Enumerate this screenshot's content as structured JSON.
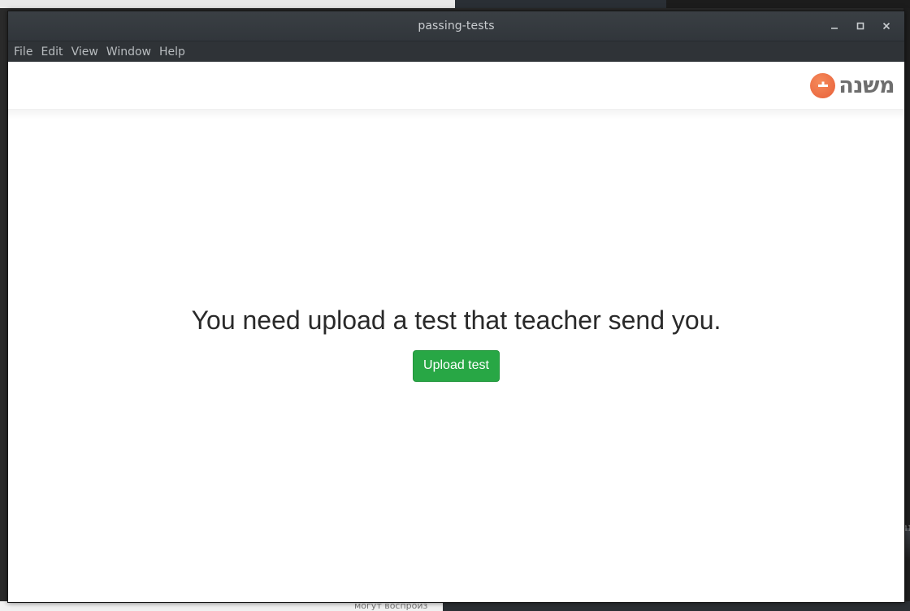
{
  "window": {
    "title": "passing-tests",
    "controls": {
      "minimize_icon": "minimize-icon",
      "maximize_icon": "maximize-icon",
      "close_icon": "close-icon"
    }
  },
  "menubar": {
    "items": [
      {
        "label": "File"
      },
      {
        "label": "Edit"
      },
      {
        "label": "View"
      },
      {
        "label": "Window"
      },
      {
        "label": "Help"
      }
    ]
  },
  "header": {
    "logo_text": "משנה",
    "logo_icon": "minus-badge-icon",
    "accent_color": "#e9673f"
  },
  "main": {
    "message": "You need upload a test that teacher send you.",
    "upload_button_label": "Upload test",
    "button_color": "#28a745"
  },
  "background": {
    "bottom_text": "могут воспроиз",
    "right_edge_text": "1II"
  }
}
